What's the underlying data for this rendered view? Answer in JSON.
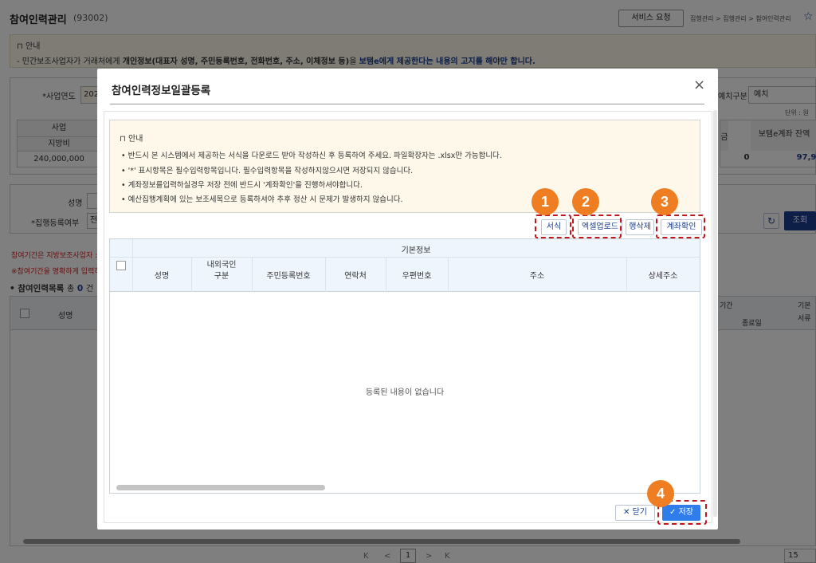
{
  "page": {
    "title": "참여인력관리",
    "code": "(93002)",
    "service_request": "서비스 요청",
    "breadcrumb": "집행관리 > 집행관리 > 참여인력관리",
    "notice_title": "안내",
    "notice_text_plain1": "- 민간보조사업자가 거래처에게 ",
    "notice_text_bold": "개인정보(대표자 성명, 주민등록번호, 전화번호, 주소, 이체정보 등)",
    "notice_text_plain2": "을 ",
    "notice_text_blue": "보탬e에게 제공한다는 내용의 고지를 해야만 합니다.",
    "business_year_label": "*사업연도",
    "business_year_value": "202",
    "deposit_type_label": "예치구분",
    "deposit_type_value": "예치",
    "unit_label": "단위 : 원",
    "project_header": "사업",
    "local_fund_label": "지방비",
    "local_fund_value": "240,000,000",
    "balance_header": "보탬e계좌 잔액",
    "balance_value": "97,9",
    "zero_value": "0",
    "fee_partial": "금",
    "name_label": "성명",
    "exec_reg_label": "*집행등록여부",
    "exec_reg_value": "전",
    "reset_label": "↻",
    "search_label": "조회",
    "warn1": "참여기간은 지방보조사업자 :",
    "warn2": "※참여기간을 명확하게 입력하",
    "list_title": "• 참여인력목록",
    "list_total_label": "총",
    "list_total": "0",
    "list_total_unit": "건",
    "col_name": "성명",
    "col_period": "기간",
    "col_end_date": "종료일",
    "col_basic": "기본",
    "col_docs": "서류",
    "pager_first": "K",
    "pager_prev": "<",
    "pager_current": "1",
    "pager_next": ">",
    "pager_last": "K",
    "page_size": "15"
  },
  "modal": {
    "title": "참여인력정보일괄등록",
    "close_label": "×",
    "notice_title": "안내",
    "notice_lines": [
      "반드시 본 시스템에서 제공하는 서식을 다운로드 받아 작성하신 후 등록하여 주세요. 파일확장자는 .xlsx만 가능합니다.",
      "'*' 표시항목은 필수입력항목입니다. 필수입력항목을 작성하지않으시면 저장되지 않습니다.",
      "계좌정보를입력하실경우 저장 전에 반드시 '계좌확인'을 진행하셔야합니다.",
      "예산집행계획에 있는 보조세목으로 등록하셔야 추후 정산 시 문제가 발생하지 않습니다."
    ],
    "btn_template": "서식",
    "btn_excel_upload": "엑셀업로드",
    "btn_delete_row": "행삭제",
    "btn_account_check": "계좌확인",
    "group_header": "기본정보",
    "columns": [
      "성명",
      "내외국인\n구분",
      "주민등록번호",
      "연락처",
      "우편번호",
      "주소",
      "상세주소"
    ],
    "empty_message": "등록된 내용이 없습니다",
    "btn_close": "닫기",
    "btn_save": "저장"
  },
  "callouts": [
    "1",
    "2",
    "3",
    "4"
  ],
  "colors": {
    "accent": "#1b3f8f",
    "save_button": "#2f7dea",
    "callout": "#ef7d22",
    "highlight_border": "#c0171e",
    "notice_bg": "#fdf8ea",
    "table_header_bg": "#eef5fd"
  }
}
